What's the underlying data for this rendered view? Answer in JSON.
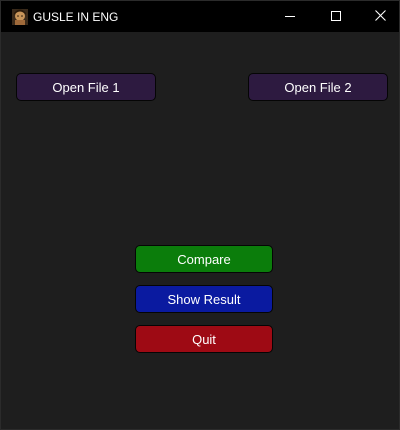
{
  "window": {
    "title": "GUSLE IN ENG",
    "icon": "avatar-app-icon",
    "controls": [
      "minimize-icon",
      "maximize-icon",
      "close-icon"
    ]
  },
  "buttons": {
    "open_file_1": "Open File 1",
    "open_file_2": "Open File 2",
    "compare": "Compare",
    "show_result": "Show Result",
    "quit": "Quit"
  },
  "colors": {
    "window_bg": "#1e1e1e",
    "titlebar_bg": "#000000",
    "open_file_btn": "#2d1a40",
    "compare_btn": "#0b7d0b",
    "show_result_btn": "#0a1aa0",
    "quit_btn": "#9e0a14"
  }
}
